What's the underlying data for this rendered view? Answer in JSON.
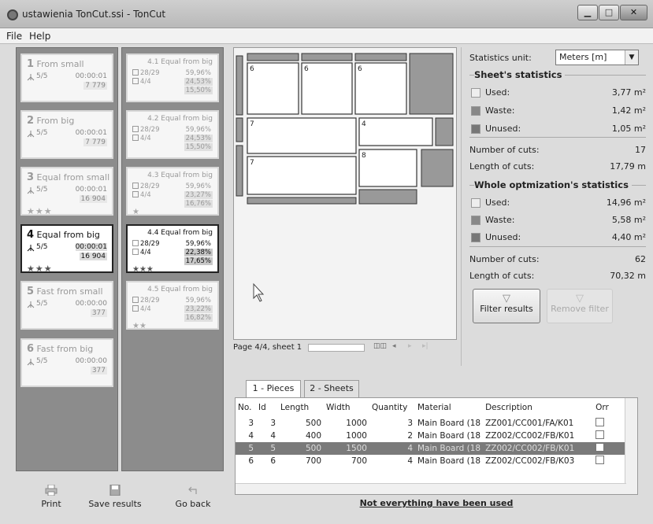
{
  "window": {
    "title": "ustawienia TonCut.ssi - TonCut",
    "minimize": "▁",
    "maximize": "□",
    "close": "✕"
  },
  "menu": [
    "File",
    "Help"
  ],
  "results": [
    {
      "num": "1",
      "name": "From small",
      "sheets": "5/5",
      "time": "00:00:01",
      "length": "7 779",
      "stars": "",
      "selected": false
    },
    {
      "num": "2",
      "name": "From big",
      "sheets": "5/5",
      "time": "00:00:01",
      "length": "7 779",
      "stars": "",
      "selected": false
    },
    {
      "num": "3",
      "name": "Equal from small",
      "sheets": "5/5",
      "time": "00:00:01",
      "length": "16 904",
      "stars": "★★★",
      "selected": false
    },
    {
      "num": "4",
      "name": "Equal from big",
      "sheets": "5/5",
      "time": "00:00:01",
      "length": "16 904",
      "stars": "★★★",
      "selected": true
    },
    {
      "num": "5",
      "name": "Fast from small",
      "sheets": "5/5",
      "time": "00:00:00",
      "length": "377",
      "stars": "",
      "selected": false
    },
    {
      "num": "6",
      "name": "Fast from big",
      "sheets": "5/5",
      "time": "00:00:00",
      "length": "377",
      "stars": "",
      "selected": false
    }
  ],
  "subresults": [
    {
      "title": "4.1 Equal from big",
      "r1": "28/29",
      "p1": "59,96%",
      "r2": "4/4",
      "p2": "24,53%",
      "p3": "15,50%",
      "stars": "",
      "selected": false
    },
    {
      "title": "4.2 Equal from big",
      "r1": "28/29",
      "p1": "59,96%",
      "r2": "4/4",
      "p2": "24,53%",
      "p3": "15,50%",
      "stars": "",
      "selected": false
    },
    {
      "title": "4.3 Equal from big",
      "r1": "28/29",
      "p1": "59,96%",
      "r2": "4/4",
      "p2": "23,27%",
      "p3": "16,76%",
      "stars": "★",
      "selected": false
    },
    {
      "title": "4.4 Equal from big",
      "r1": "28/29",
      "p1": "59,96%",
      "r2": "4/4",
      "p2": "22,38%",
      "p3": "17,65%",
      "stars": "★★★",
      "selected": true
    },
    {
      "title": "4.5 Equal from big",
      "r1": "28/29",
      "p1": "59,96%",
      "r2": "4/4",
      "p2": "23,22%",
      "p3": "16,82%",
      "stars": "★★",
      "selected": false
    }
  ],
  "toolbar": {
    "print": "Print",
    "save": "Save results",
    "back": "Go back"
  },
  "sheet_view": {
    "piece_labels": [
      "6",
      "6",
      "6",
      "7",
      "4",
      "7",
      "8"
    ],
    "page_info": "Page 4/4, sheet 1"
  },
  "stats": {
    "unit_label": "Statistics unit:",
    "unit_value": "Meters [m]",
    "sheet_title": "Sheet's statistics",
    "sheet": {
      "used_label": "Used:",
      "used": "3,77 m²",
      "waste_label": "Waste:",
      "waste": "1,42 m²",
      "unused_label": "Unused:",
      "unused": "1,05 m²",
      "cuts_label": "Number of cuts:",
      "cuts": "17",
      "length_label": "Length of cuts:",
      "length": "17,79 m"
    },
    "whole_title": "Whole optmization's statistics",
    "whole": {
      "used_label": "Used:",
      "used": "14,96 m²",
      "waste_label": "Waste:",
      "waste": "5,58 m²",
      "unused_label": "Unused:",
      "unused": "4,40 m²",
      "cuts_label": "Number of cuts:",
      "cuts": "62",
      "length_label": "Length of cuts:",
      "length": "70,32 m"
    },
    "filter_label": "Filter results",
    "remove_filter_label": "Remove filter"
  },
  "tabs": [
    "1 - Pieces",
    "2 - Sheets"
  ],
  "table": {
    "headers": [
      "No.",
      "Id",
      "Length",
      "Width",
      "Quantity",
      "Material",
      "Description",
      "Orr"
    ],
    "rows": [
      {
        "no": "3",
        "id": "3",
        "length": "500",
        "width": "1000",
        "qty": "3",
        "material": "Main Board  (18",
        "desc": "ZZ001/CC001/FA/K01",
        "hl": false
      },
      {
        "no": "4",
        "id": "4",
        "length": "400",
        "width": "1000",
        "qty": "2",
        "material": "Main Board  (18",
        "desc": "ZZ002/CC002/FB/K01",
        "hl": false
      },
      {
        "no": "5",
        "id": "5",
        "length": "500",
        "width": "1500",
        "qty": "4",
        "material": "Main Board  (18",
        "desc": "ZZ002/CC002/FB/K01",
        "hl": true
      },
      {
        "no": "6",
        "id": "6",
        "length": "700",
        "width": "700",
        "qty": "4",
        "material": "Main Board  (18",
        "desc": "ZZ002/CC002/FB/K03",
        "hl": false
      }
    ]
  },
  "status": "Not everything have been used"
}
